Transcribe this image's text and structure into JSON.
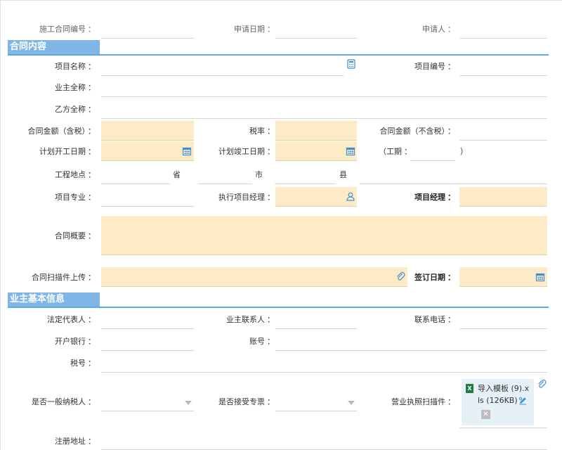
{
  "colon": "：",
  "header": {
    "contract_no_label": "施工合同编号",
    "apply_date_label": "申请日期",
    "applicant_label": "申请人"
  },
  "contract_section": {
    "title": "合同内容",
    "project_name_label": "项目名称",
    "project_no_label": "项目编号",
    "owner_full_name_label": "业主全称",
    "party_b_full_name_label": "乙方全称",
    "amount_incl_tax_label": "合同金额（含税）",
    "tax_rate_label": "税率",
    "amount_excl_tax_label": "合同金额（不含税）",
    "planned_start_label": "计划开工日期",
    "planned_end_label": "计划竣工日期",
    "duration_open": "（工期",
    "duration_close": "）",
    "location_label": "工程地点",
    "province_unit": "省",
    "city_unit": "市",
    "county_unit": "县",
    "specialty_label": "项目专业",
    "exec_manager_label": "执行项目经理",
    "project_manager_label": "项目经理",
    "summary_label": "合同概要",
    "scan_upload_label": "合同扫描件上传",
    "sign_date_label": "签订日期"
  },
  "owner_section": {
    "title": "业主基本信息",
    "legal_rep_label": "法定代表人",
    "owner_contact_label": "业主联系人",
    "phone_label": "联系电话",
    "bank_label": "开户银行",
    "account_label": "账号",
    "tax_no_label": "税号",
    "general_taxpayer_label": "是否一般纳税人",
    "accept_special_invoice_label": "是否接受专票",
    "license_scan_label": "营业执照扫描件",
    "registered_address_label": "注册地址",
    "attachment": {
      "file_name": "导入模板 (9).xls (126KB)",
      "file_type_badge": "X"
    }
  },
  "colors": {
    "section_title_bg": "#7fb6e6",
    "section_rule": "#5ea8e0",
    "required_field_bg": "#fdebc8",
    "icon_blue": "#3b8fd4"
  }
}
